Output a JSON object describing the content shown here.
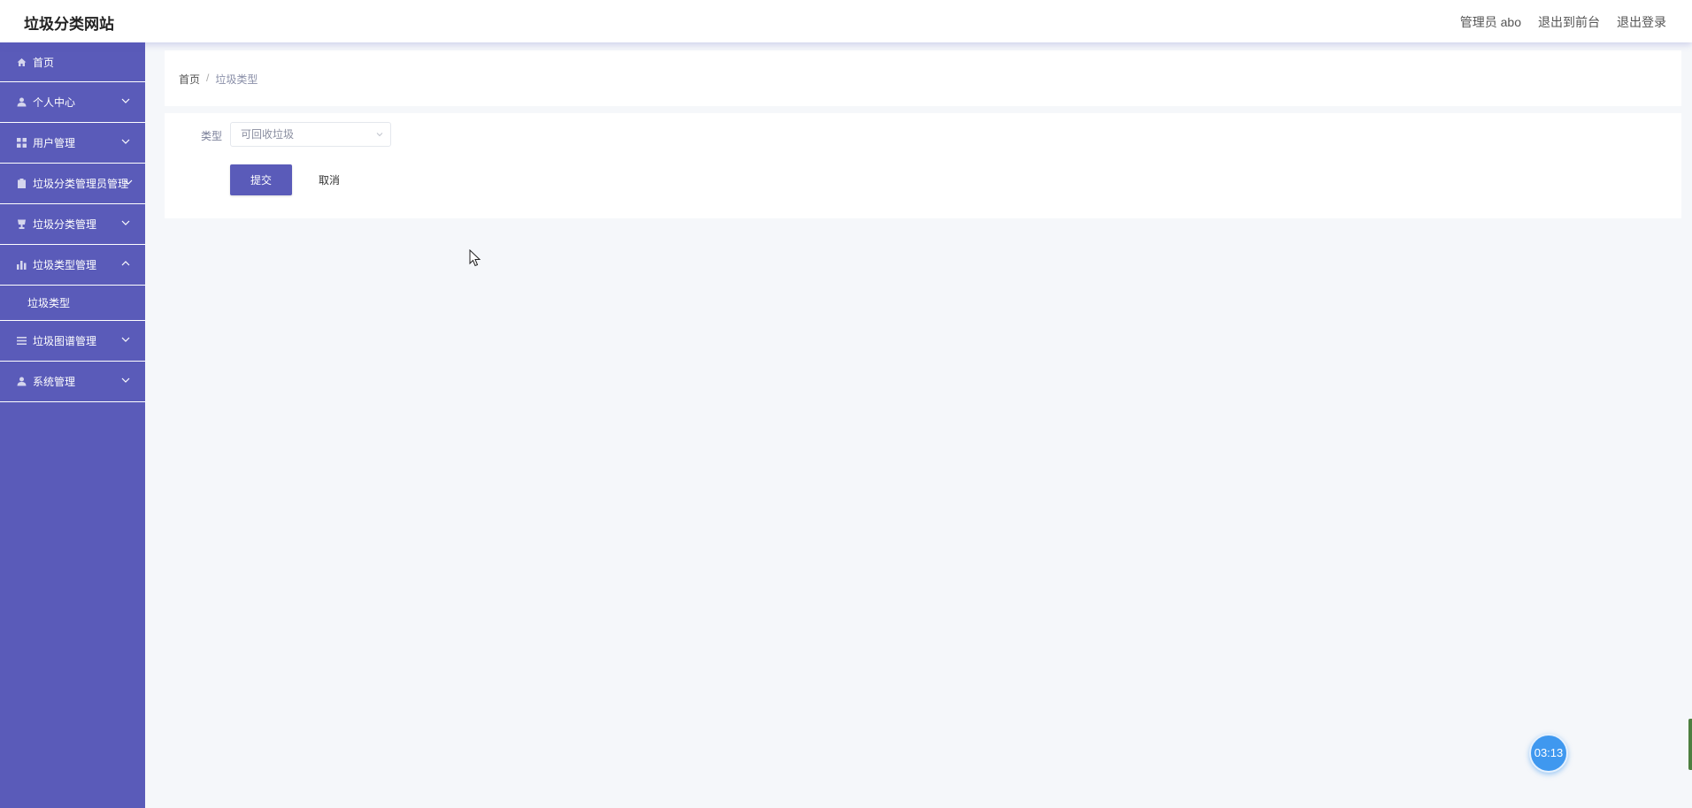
{
  "app": {
    "title": "垃圾分类网站"
  },
  "header": {
    "user_label": "管理员 abo",
    "back_to_front": "退出到前台",
    "logout": "退出登录"
  },
  "sidebar": {
    "items": [
      {
        "label": "首页",
        "icon": "home-icon"
      },
      {
        "label": "个人中心",
        "icon": "user-icon"
      },
      {
        "label": "用户管理",
        "icon": "grid-icon"
      },
      {
        "label": "垃圾分类管理员管理",
        "icon": "clipboard-icon"
      },
      {
        "label": "垃圾分类管理",
        "icon": "trophy-icon"
      },
      {
        "label": "垃圾类型管理",
        "icon": "bar-chart-icon",
        "expanded": true
      },
      {
        "label": "垃圾图谱管理",
        "icon": "list-icon"
      },
      {
        "label": "系统管理",
        "icon": "user-icon"
      }
    ],
    "sub_items": [
      {
        "label": "垃圾类型"
      }
    ]
  },
  "breadcrumb": {
    "home": "首页",
    "separator": "/",
    "current": "垃圾类型"
  },
  "form": {
    "type_label": "类型",
    "type_value": "可回收垃圾",
    "submit_label": "提交",
    "cancel_label": "取消"
  },
  "timer": {
    "text": "03:13"
  },
  "colors": {
    "sidebar": "#5a5bb9",
    "primary_button": "#5a5bb9",
    "page_background": "#f5f7fa",
    "timer": "#3f98ef"
  }
}
